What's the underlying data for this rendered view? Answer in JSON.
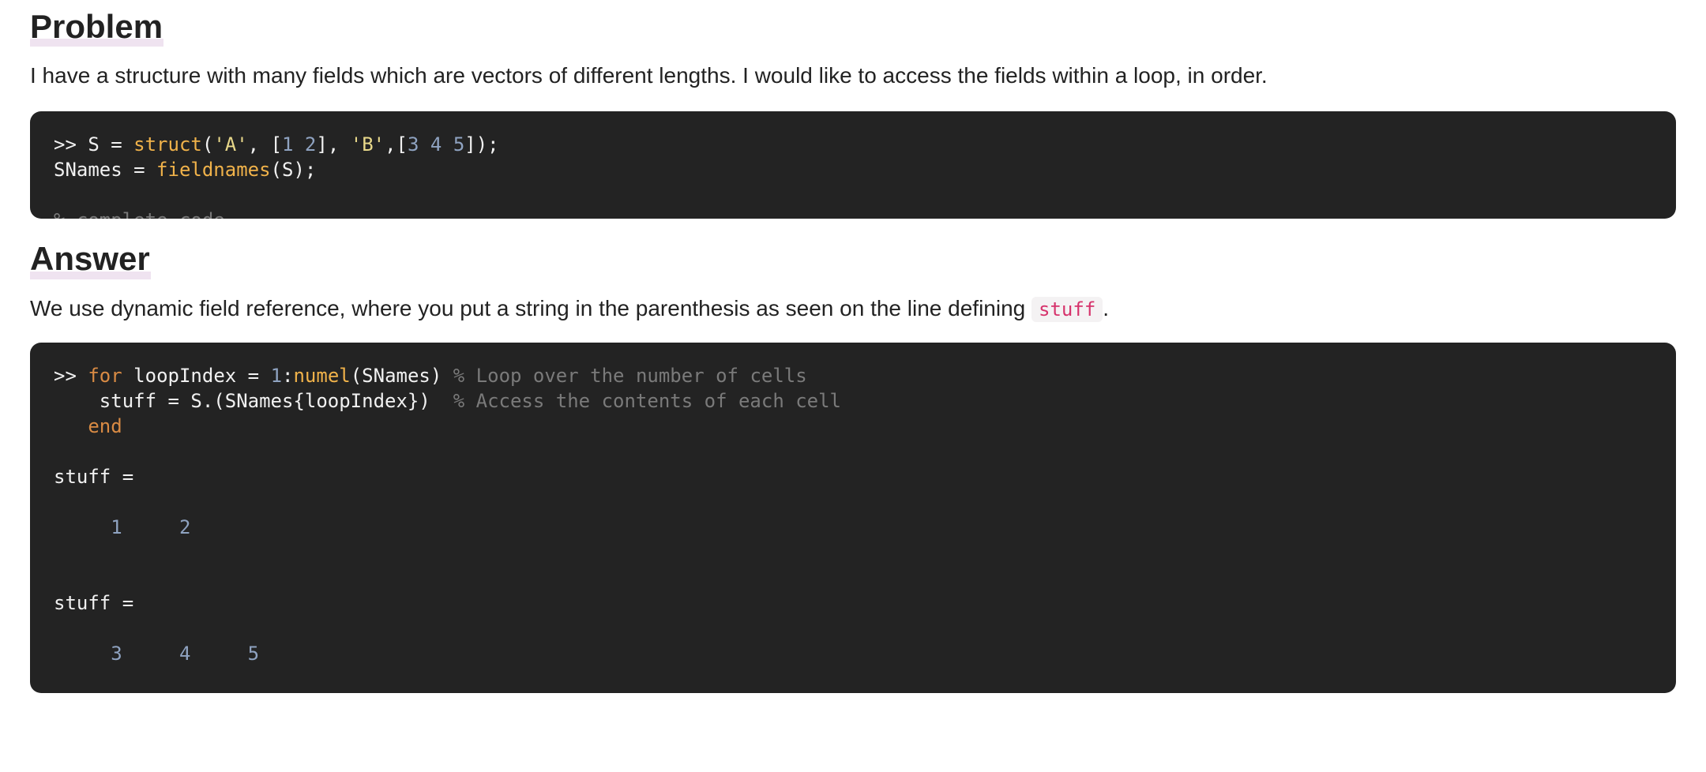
{
  "problem": {
    "heading": "Problem",
    "paragraph": "I have a structure with many fields which are vectors of different lengths. I would like to access the fields within a loop, in order.",
    "code_lines": [
      [
        {
          "t": ">> S = ",
          "c": "pl"
        },
        {
          "t": "struct",
          "c": "fn"
        },
        {
          "t": "(",
          "c": "pl"
        },
        {
          "t": "'A'",
          "c": "str"
        },
        {
          "t": ", [",
          "c": "pl"
        },
        {
          "t": "1 2",
          "c": "num"
        },
        {
          "t": "], ",
          "c": "pl"
        },
        {
          "t": "'B'",
          "c": "str"
        },
        {
          "t": ",[",
          "c": "pl"
        },
        {
          "t": "3 4 5",
          "c": "num"
        },
        {
          "t": "]);",
          "c": "pl"
        }
      ],
      [
        {
          "t": "SNames = ",
          "c": "pl"
        },
        {
          "t": "fieldnames",
          "c": "fn"
        },
        {
          "t": "(S);",
          "c": "pl"
        }
      ],
      [],
      [
        {
          "t": "% complete code",
          "c": "cm"
        }
      ]
    ]
  },
  "answer": {
    "heading": "Answer",
    "paragraph_before": "We use dynamic field reference, where you put a string in the parenthesis as seen on the line defining ",
    "inline_code": "stuff",
    "paragraph_after": ".",
    "code_lines": [
      [
        {
          "t": ">> ",
          "c": "pl"
        },
        {
          "t": "for",
          "c": "kw"
        },
        {
          "t": " loopIndex = ",
          "c": "pl"
        },
        {
          "t": "1",
          "c": "num"
        },
        {
          "t": ":",
          "c": "pl"
        },
        {
          "t": "numel",
          "c": "fn"
        },
        {
          "t": "(SNames) ",
          "c": "pl"
        },
        {
          "t": "% Loop over the number of cells",
          "c": "cm"
        }
      ],
      [
        {
          "t": "    stuff = S.(SNames{loopIndex})  ",
          "c": "pl"
        },
        {
          "t": "% Access the contents of each cell",
          "c": "cm"
        }
      ],
      [
        {
          "t": "   ",
          "c": "pl"
        },
        {
          "t": "end",
          "c": "kw"
        }
      ],
      [],
      [
        {
          "t": "stuff =",
          "c": "pl"
        }
      ],
      [],
      [
        {
          "t": "     ",
          "c": "pl"
        },
        {
          "t": "1",
          "c": "num"
        },
        {
          "t": "     ",
          "c": "pl"
        },
        {
          "t": "2",
          "c": "num"
        }
      ],
      [],
      [],
      [
        {
          "t": "stuff =",
          "c": "pl"
        }
      ],
      [],
      [
        {
          "t": "     ",
          "c": "pl"
        },
        {
          "t": "3",
          "c": "num"
        },
        {
          "t": "     ",
          "c": "pl"
        },
        {
          "t": "4",
          "c": "num"
        },
        {
          "t": "     ",
          "c": "pl"
        },
        {
          "t": "5",
          "c": "num"
        }
      ]
    ]
  }
}
